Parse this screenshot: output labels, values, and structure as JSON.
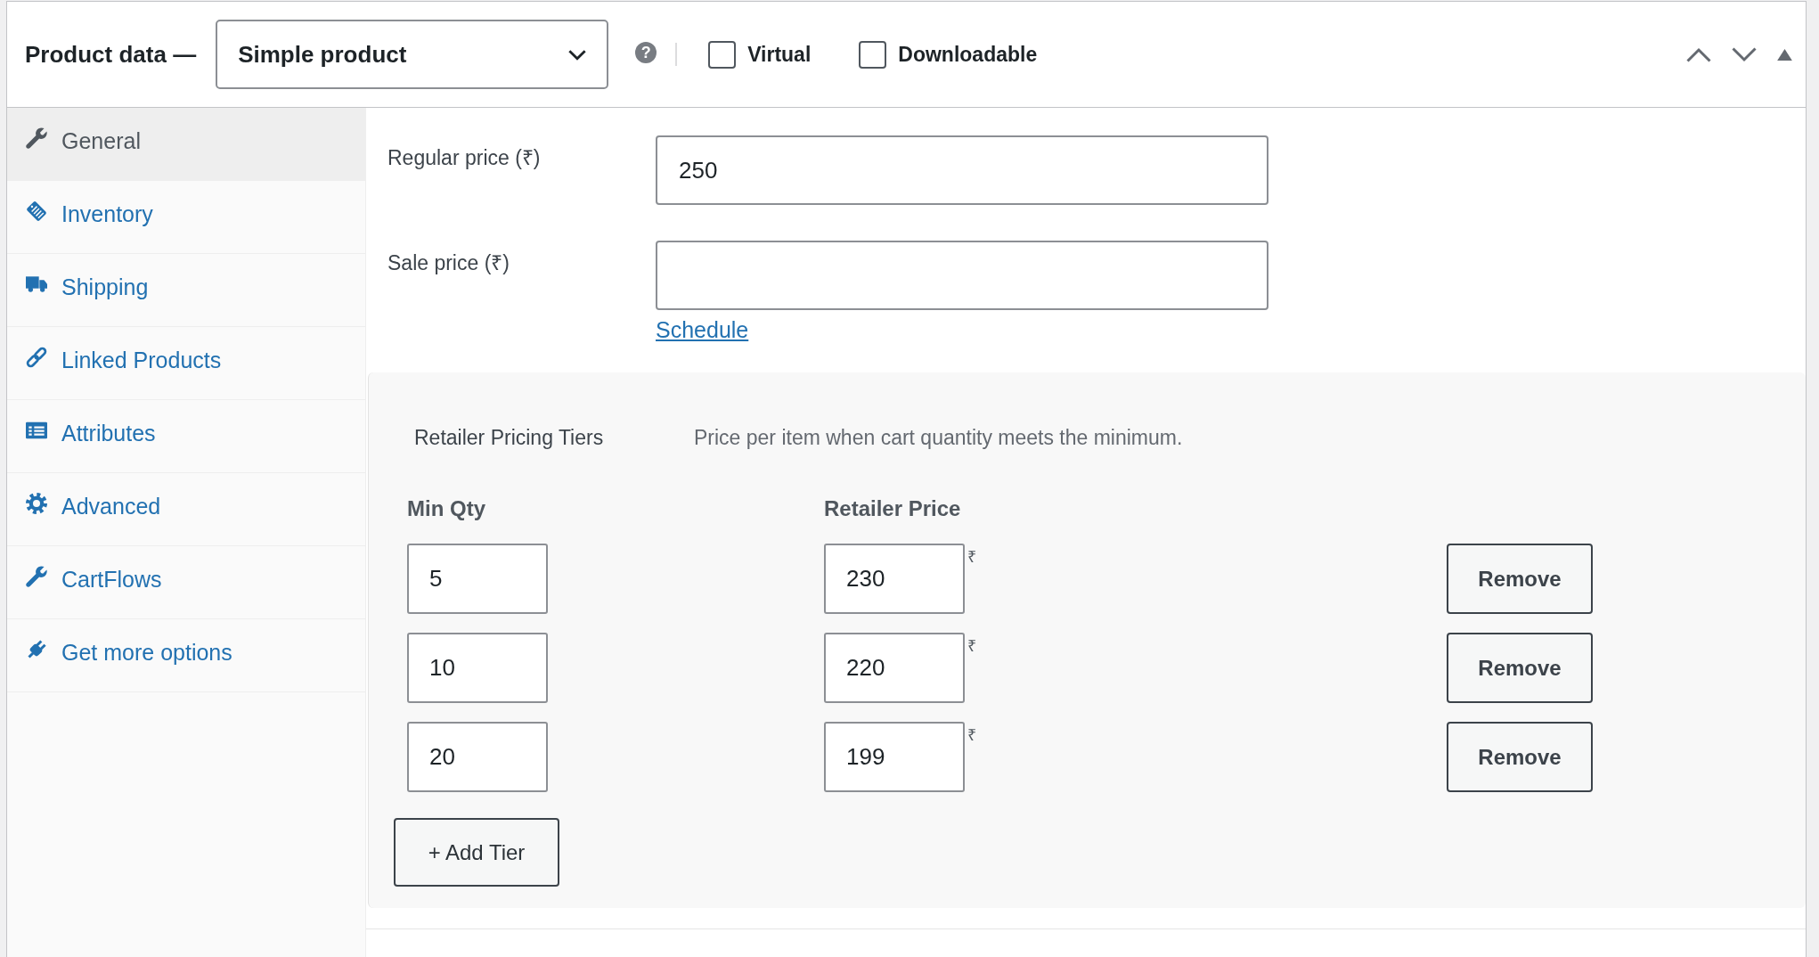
{
  "header": {
    "title": "Product data —",
    "product_type": {
      "value": "Simple product"
    },
    "help": "?",
    "options": [
      {
        "label": "Virtual",
        "checked": false
      },
      {
        "label": "Downloadable",
        "checked": false
      }
    ]
  },
  "tabs": [
    {
      "label": "General",
      "selected": true
    },
    {
      "label": "Inventory",
      "selected": false
    },
    {
      "label": "Shipping",
      "selected": false
    },
    {
      "label": "Linked Products",
      "selected": false
    },
    {
      "label": "Attributes",
      "selected": false
    },
    {
      "label": "Advanced",
      "selected": false
    },
    {
      "label": "CartFlows",
      "selected": false
    },
    {
      "label": "Get more options",
      "selected": false
    }
  ],
  "price_fields": [
    {
      "label": "Regular price (₹)",
      "value": "250"
    },
    {
      "label": "Sale price (₹)",
      "link": "Schedule"
    }
  ],
  "tiers": {
    "title": "Retailer Pricing Tiers",
    "description": "Price per item when cart quantity meets the minimum.",
    "columns": [
      "Min Qty",
      "Retailer Price"
    ],
    "rows": [
      {
        "min_qty": "5",
        "price": "230",
        "currency": "₹",
        "remove": "Remove"
      },
      {
        "min_qty": "10",
        "price": "220",
        "currency": "₹",
        "remove": "Remove"
      },
      {
        "min_qty": "20",
        "price": "199",
        "currency": "₹",
        "remove": "Remove"
      }
    ],
    "add_button": "+ Add Tier"
  }
}
